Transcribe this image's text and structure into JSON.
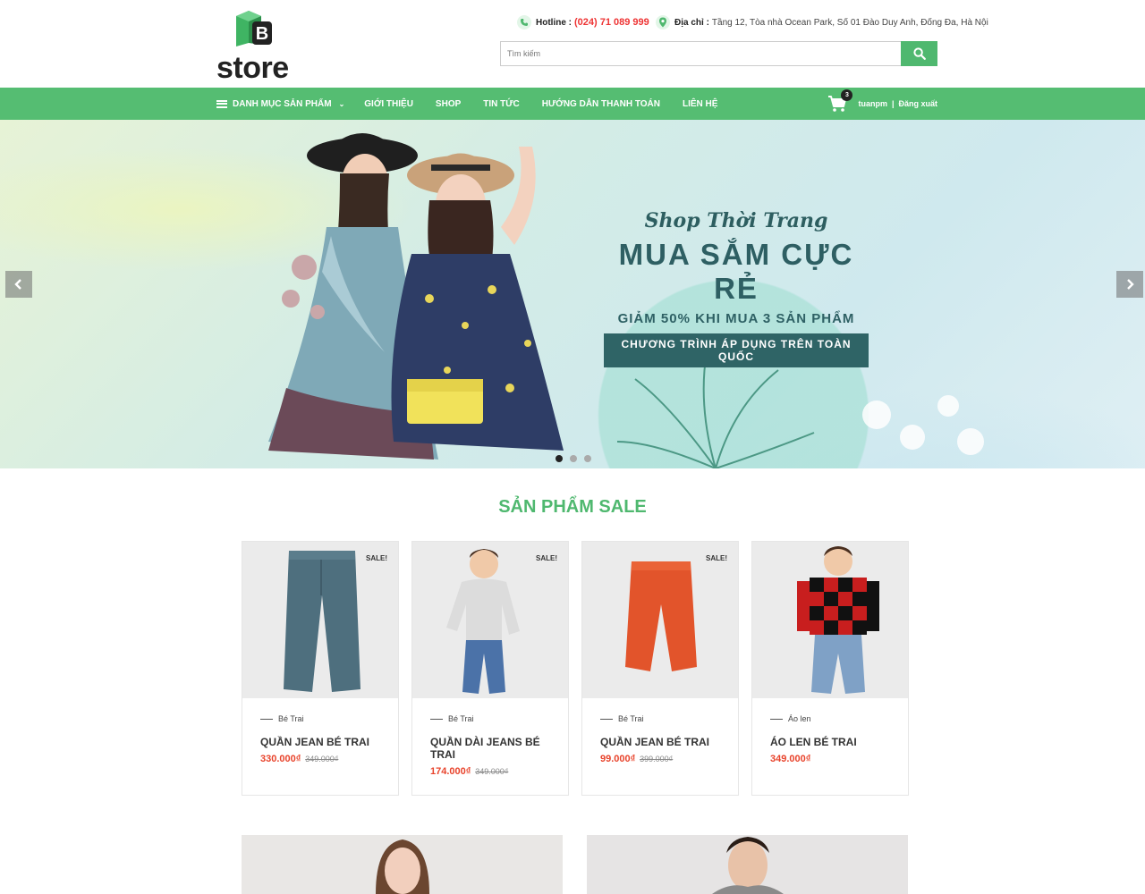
{
  "header": {
    "logo_text": "store",
    "hotline_label": "Hotline :",
    "hotline_value": "(024) 71 089 999",
    "address_label": "Địa chỉ :",
    "address_value": "Tầng 12, Tòa nhà Ocean Park, Số 01 Đào Duy Anh, Đống Đa, Hà Nội",
    "search_placeholder": "Tìm kiếm",
    "search_icon": "search-icon"
  },
  "nav": {
    "category_label": "Danh mục sản phẩm",
    "links": [
      "Giới thiệu",
      "Shop",
      "Tin tức",
      "Hướng dẫn thanh toán",
      "Liên hệ"
    ],
    "cart_count": "3",
    "username": "tuanpm",
    "separator": "|",
    "logout": "Đăng xuất"
  },
  "hero": {
    "line1": "Shop Thời Trang",
    "line2": "MUA SẮM CỰC RẺ",
    "line3": "GIẢM 50% KHI MUA 3 SẢN PHẨM",
    "line4": "CHƯƠNG TRÌNH ÁP DỤNG TRÊN TOÀN QUỐC",
    "slide_count": 3,
    "active_slide": 1
  },
  "sale_section": {
    "title": "SẢN PHẨM SALE",
    "products": [
      {
        "category": "Bé Trai",
        "name": "QUẦN JEAN BÉ TRAI",
        "price": "330.000₫",
        "old_price": "349.000₫",
        "badge": "SALE!"
      },
      {
        "category": "Bé Trai",
        "name": "QUẦN DÀI JEANS BÉ TRAI",
        "price": "174.000₫",
        "old_price": "349.000₫",
        "badge": "SALE!"
      },
      {
        "category": "Bé Trai",
        "name": "QUẦN JEAN BÉ TRAI",
        "price": "99.000₫",
        "old_price": "399.000₫",
        "badge": "SALE!"
      },
      {
        "category": "Áo len",
        "name": "ÁO LEN BÉ TRAI",
        "price": "349.000₫",
        "old_price": "",
        "badge": ""
      }
    ]
  },
  "colors": {
    "brand_green": "#55bd72",
    "price_red": "#e8432b",
    "hotline_red": "#e33333"
  }
}
